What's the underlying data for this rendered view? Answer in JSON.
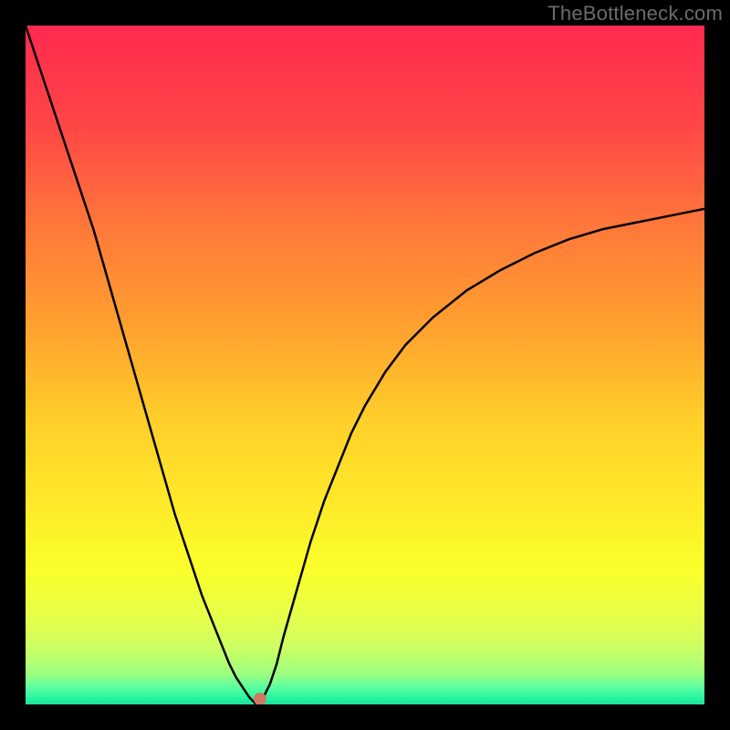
{
  "watermark": {
    "text": "TheBottleneck.com"
  },
  "frame": {
    "outer_size_px": 800,
    "border_px": 28,
    "border_color": "#000000"
  },
  "chart_data": {
    "type": "line",
    "title": "",
    "xlabel": "",
    "ylabel": "",
    "xlim": [
      0,
      100
    ],
    "ylim": [
      0,
      100
    ],
    "grid": false,
    "background_gradient": {
      "description": "vertical gradient representing bottleneck severity; red (high) at top through orange/yellow to green (low) at bottom",
      "stops": [
        {
          "pos": 0.0,
          "color": "#ff2a4f"
        },
        {
          "pos": 0.15,
          "color": "#ff4747"
        },
        {
          "pos": 0.3,
          "color": "#ff7a3a"
        },
        {
          "pos": 0.45,
          "color": "#ffa32f"
        },
        {
          "pos": 0.58,
          "color": "#ffcf2a"
        },
        {
          "pos": 0.7,
          "color": "#ffe92a"
        },
        {
          "pos": 0.8,
          "color": "#faff2a"
        },
        {
          "pos": 0.87,
          "color": "#e7ff4a"
        },
        {
          "pos": 0.92,
          "color": "#c9ff66"
        },
        {
          "pos": 0.955,
          "color": "#9dff80"
        },
        {
          "pos": 0.975,
          "color": "#5bffa0"
        },
        {
          "pos": 0.99,
          "color": "#29f5a4"
        },
        {
          "pos": 1.0,
          "color": "#18e59a"
        }
      ]
    },
    "series": [
      {
        "name": "bottleneck-curve",
        "color": "#000000",
        "stroke_width": 2.5,
        "x": [
          0,
          2,
          4,
          6,
          8,
          10,
          12,
          14,
          16,
          18,
          20,
          22,
          24,
          26,
          28,
          30,
          31,
          32,
          33,
          34,
          35,
          36,
          37,
          38,
          40,
          42,
          44,
          46,
          48,
          50,
          53,
          56,
          60,
          65,
          70,
          75,
          80,
          85,
          90,
          95,
          100
        ],
        "y": [
          100,
          94,
          88,
          82,
          76,
          70,
          63,
          56,
          49,
          42,
          35,
          28,
          22,
          16,
          11,
          6,
          4,
          2.5,
          1,
          0,
          1,
          3,
          6,
          10,
          17,
          24,
          30,
          35,
          40,
          44,
          49,
          53,
          57,
          61,
          64,
          66.5,
          68.5,
          70,
          71,
          72,
          73
        ]
      }
    ],
    "marker": {
      "name": "selected-point",
      "x": 34.5,
      "y": 0.8,
      "color": "#cf7a63",
      "radius_px": 7
    }
  }
}
